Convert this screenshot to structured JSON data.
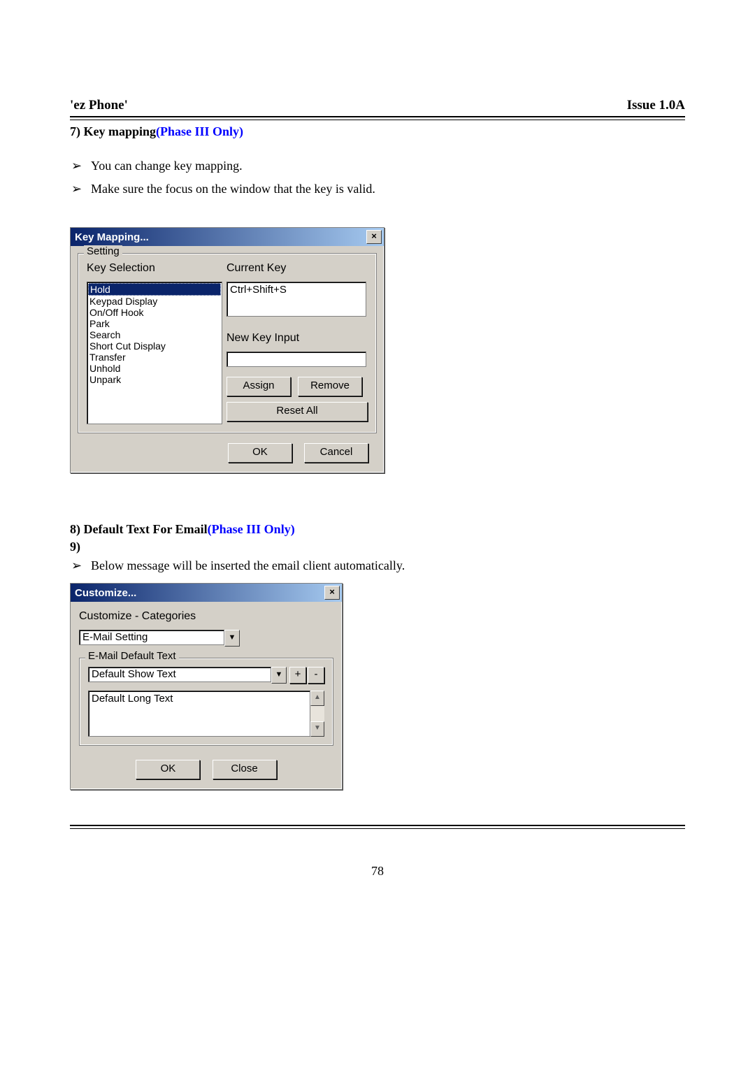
{
  "header": {
    "left": "'ez Phone'",
    "right": "Issue 1.0A"
  },
  "section7": {
    "heading_num": "7)",
    "heading_text": "Key mapping",
    "heading_note": "(Phase III Only)",
    "bullets": [
      "You can change key mapping.",
      "Make sure the focus on the window that the key is valid."
    ]
  },
  "keymap_dialog": {
    "title": "Key Mapping...",
    "group_legend": "Setting",
    "key_selection_label": "Key Selection",
    "current_key_label": "Current Key",
    "current_key_value": "Ctrl+Shift+S",
    "new_key_label": "New Key Input",
    "new_key_value": "",
    "list_items": [
      "Hold",
      "Keypad Display",
      "On/Off Hook",
      "Park",
      "Search",
      "Short Cut Display",
      "Transfer",
      "Unhold",
      "Unpark"
    ],
    "selected_index": 0,
    "buttons": {
      "assign": "Assign",
      "remove": "Remove",
      "reset": "Reset All",
      "ok": "OK",
      "cancel": "Cancel"
    }
  },
  "section8": {
    "heading_num": "8)",
    "heading_text": "Default Text For Email",
    "heading_note": "(Phase III Only)",
    "nine": "9)",
    "bullets": [
      "Below message will be inserted the email client automatically."
    ]
  },
  "customize_dialog": {
    "title": "Customize...",
    "cat_label": "Customize - Categories",
    "cat_value": "E-Mail Setting",
    "group_legend": "E-Mail Default Text",
    "show_value": "Default Show Text",
    "long_value": "Default Long Text",
    "plus": "+",
    "minus": "-",
    "buttons": {
      "ok": "OK",
      "close": "Close"
    }
  },
  "page_number": "78"
}
